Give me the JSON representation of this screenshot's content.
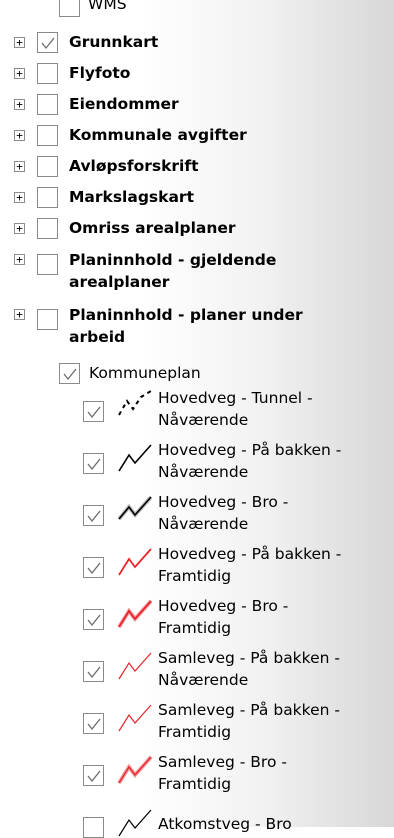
{
  "layers_panel": {
    "top_partial": {
      "label": "WMS",
      "checked": false
    },
    "groups": [
      {
        "label": "Grunnkart",
        "checked": true,
        "expander": "+"
      },
      {
        "label": "Flyfoto",
        "checked": false,
        "expander": "+"
      },
      {
        "label": "Eiendommer",
        "checked": false,
        "expander": "+"
      },
      {
        "label": "Kommunale avgifter",
        "checked": false,
        "expander": "+"
      },
      {
        "label": "Avløpsforskrift",
        "checked": false,
        "expander": "+"
      },
      {
        "label": "Markslagskart",
        "checked": false,
        "expander": "+"
      },
      {
        "label": "Omriss arealplaner",
        "checked": false,
        "expander": "+"
      },
      {
        "label_line1": "Planinnhold - gjeldende",
        "label_line2": "arealplaner",
        "checked": false,
        "expander": "+"
      },
      {
        "label_line1": "Planinnhold - planer under",
        "label_line2": "arbeid",
        "checked": false,
        "expander": "+"
      }
    ],
    "subgroup": {
      "label": "Kommuneplan",
      "checked": true
    },
    "legend_layers": [
      {
        "line1": "Hovedveg - Tunnel -",
        "line2": "Nåværende",
        "checked": true,
        "icon": "dashed-black-line-icon",
        "color": "#000000"
      },
      {
        "line1": "Hovedveg - På bakken -",
        "line2": "Nåværende",
        "checked": true,
        "icon": "black-line-icon",
        "color": "#000000"
      },
      {
        "line1": "Hovedveg - Bro -",
        "line2": "Nåværende",
        "checked": true,
        "icon": "black-bridge-line-icon",
        "color": "#000000"
      },
      {
        "line1": "Hovedveg - På bakken -",
        "line2": "Framtidig",
        "checked": true,
        "icon": "red-line-icon",
        "color": "#e8242a"
      },
      {
        "line1": "Hovedveg - Bro -",
        "line2": "Framtidig",
        "checked": true,
        "icon": "red-bridge-line-icon",
        "color": "#e8242a"
      },
      {
        "line1": "Samleveg - På bakken -",
        "line2": "Nåværende",
        "checked": true,
        "icon": "red-thin-line-icon",
        "color": "#e8242a"
      },
      {
        "line1": "Samleveg - På bakken -",
        "line2": "Framtidig",
        "checked": true,
        "icon": "red-thin-line-icon",
        "color": "#e8242a"
      },
      {
        "line1": "Samleveg - Bro -",
        "line2": "Framtidig",
        "checked": true,
        "icon": "red-bridge-line-icon",
        "color": "#e8242a"
      }
    ],
    "bottom_partial": {
      "label": "Atkomstveg - Bro",
      "checked": true
    }
  }
}
